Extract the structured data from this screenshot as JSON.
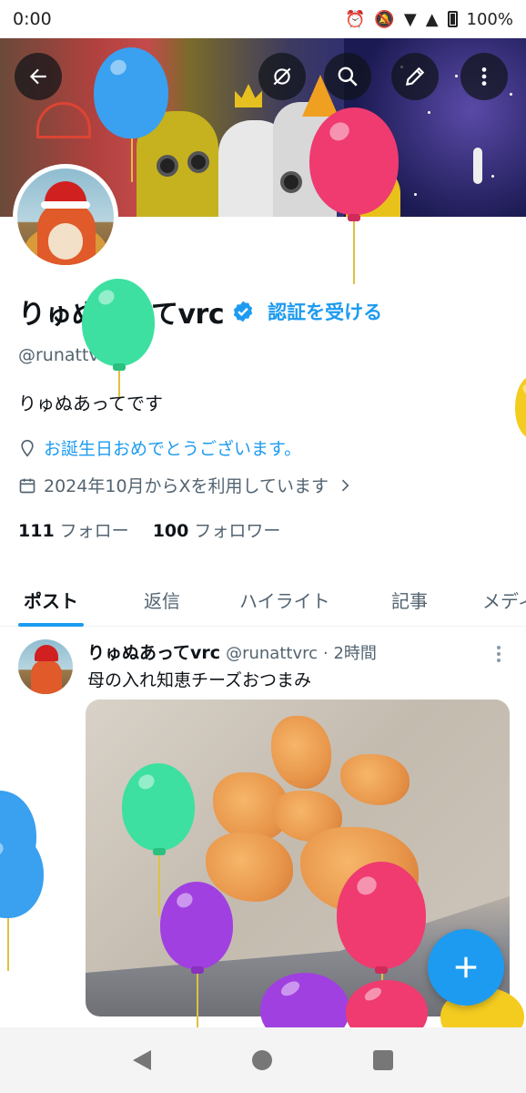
{
  "status_bar": {
    "time": "0:00",
    "battery": "100%"
  },
  "profile": {
    "display_name": "りゅぬあってvrc",
    "verify_link": "認証を受ける",
    "handle": "@runattvrc",
    "bio": "りゅぬあってです",
    "birthday_text": "お誕生日おめでとうございます。",
    "joined_text": "2024年10月からXを利用しています",
    "following_count": "111",
    "following_label": "フォロー",
    "followers_count": "100",
    "followers_label": "フォロワー"
  },
  "tabs": [
    {
      "label": "ポスト"
    },
    {
      "label": "返信"
    },
    {
      "label": "ハイライト"
    },
    {
      "label": "記事"
    },
    {
      "label": "メディア"
    }
  ],
  "post": {
    "author": "りゅぬあってvrc",
    "handle": "@runattvrc",
    "time": "· 2時間",
    "text": "母の入れ知恵チーズおつまみ"
  },
  "colors": {
    "accent": "#1d9bf0",
    "text": "#0f1419",
    "muted": "#536471"
  },
  "icons": [
    "back-arrow-icon",
    "hide-icon",
    "search-icon",
    "edit-icon",
    "more-vertical-icon",
    "verified-badge-icon",
    "location-pin-icon",
    "calendar-icon",
    "chevron-right-icon",
    "plus-icon"
  ]
}
